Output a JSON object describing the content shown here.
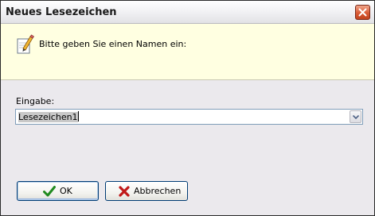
{
  "window": {
    "title": "Neues Lesezeichen"
  },
  "header": {
    "prompt": "Bitte geben Sie einen Namen ein:",
    "icon": "pencil-icon"
  },
  "form": {
    "field_label": "Eingabe:",
    "input_value": "Lesezeichen1"
  },
  "buttons": {
    "ok_label": "OK",
    "cancel_label": "Abbrechen"
  },
  "colors": {
    "header_background": "#ffffe1",
    "dialog_background": "#ebe9ed",
    "close_button": "#d95a35",
    "ok_icon": "#1f8a1f",
    "cancel_icon": "#c01818"
  }
}
